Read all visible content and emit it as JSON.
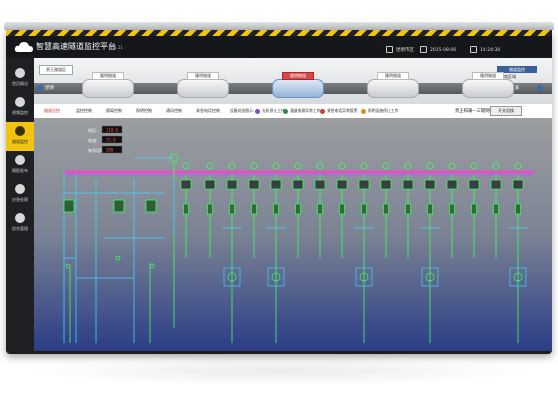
{
  "app": {
    "title": "智慧高速隧道监控平台",
    "version": "V 1.11"
  },
  "topbar": {
    "location": "昆明市区",
    "date": "2015-08-06",
    "time": "14:24:30"
  },
  "sidebar": {
    "items": [
      {
        "label": "首页概况",
        "icon": "dashboard-icon"
      },
      {
        "label": "视频监控",
        "icon": "camera-icon"
      },
      {
        "label": "隧道监控",
        "icon": "tunnel-icon"
      },
      {
        "label": "情报发布",
        "icon": "broadcast-icon"
      },
      {
        "label": "应急处理",
        "icon": "alert-icon"
      },
      {
        "label": "综合管理",
        "icon": "gear-icon"
      }
    ]
  },
  "banner": {
    "tab": "贵王隧道区",
    "status": "隧道监控",
    "cloud": "云南区域",
    "direction_left": "昆明",
    "direction_right": "玉溪",
    "tunnels": [
      {
        "label": "隆明隧道",
        "highlight": false
      },
      {
        "label": "隆明隧道",
        "highlight": false
      },
      {
        "label": "隆明隧道",
        "highlight": true
      },
      {
        "label": "隆明隧道",
        "highlight": false
      },
      {
        "label": "隆明隧道",
        "highlight": false
      }
    ]
  },
  "tabs": [
    {
      "label": "隧道总控",
      "active": true
    },
    {
      "label": "监控控制",
      "active": false
    },
    {
      "label": "隔离控制",
      "active": false
    },
    {
      "label": "照明控制",
      "active": false
    },
    {
      "label": "通风控制",
      "active": false
    },
    {
      "label": "紧急电话控制",
      "active": false
    }
  ],
  "legend": [
    {
      "label": "设备状态图示：",
      "color": ""
    },
    {
      "label": "无机停止工作",
      "color": "#7c4fc2"
    },
    {
      "label": "通道电源异常工作",
      "color": "#2d8a4a"
    },
    {
      "label": "紧急电话异常报警",
      "color": "#d03a3a"
    },
    {
      "label": "照明设施停止工作",
      "color": "#e08a20"
    }
  ],
  "selector": {
    "label": "贵王和谦—三隧明隧道",
    "button": "开关组操"
  },
  "meters": [
    {
      "label": "电压：",
      "value": "110.6"
    },
    {
      "label": "电流：",
      "value": "75.8"
    },
    {
      "label": "有功功率：",
      "value": "380"
    }
  ],
  "colors": {
    "busbar": "#ff3fd2",
    "line": "#3ed3ff",
    "device": "#3dff5a",
    "highlight": "#d34a4a"
  }
}
